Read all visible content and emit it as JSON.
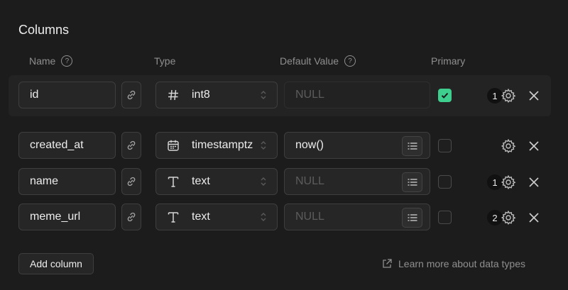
{
  "section": {
    "title": "Columns"
  },
  "headers": {
    "name": "Name",
    "type": "Type",
    "default_value": "Default Value",
    "primary": "Primary",
    "help_glyph": "?"
  },
  "rows": [
    {
      "name": "id",
      "type": "int8",
      "type_icon": "hash-icon",
      "default": "",
      "default_placeholder": "NULL",
      "default_disabled": true,
      "primary": true,
      "badge": "1"
    },
    {
      "name": "created_at",
      "type": "timestamptz",
      "type_icon": "calendar-icon",
      "default": "now()",
      "default_placeholder": "NULL",
      "default_disabled": false,
      "primary": false,
      "badge": ""
    },
    {
      "name": "name",
      "type": "text",
      "type_icon": "text-type-icon",
      "default": "",
      "default_placeholder": "NULL",
      "default_disabled": false,
      "primary": false,
      "badge": "1"
    },
    {
      "name": "meme_url",
      "type": "text",
      "type_icon": "text-type-icon",
      "default": "",
      "default_placeholder": "NULL",
      "default_disabled": false,
      "primary": false,
      "badge": "2"
    }
  ],
  "actions": {
    "add_column": "Add column",
    "learn_more": "Learn more about data types"
  },
  "colors": {
    "accent": "#3ecf8e",
    "background": "#1c1c1c"
  }
}
